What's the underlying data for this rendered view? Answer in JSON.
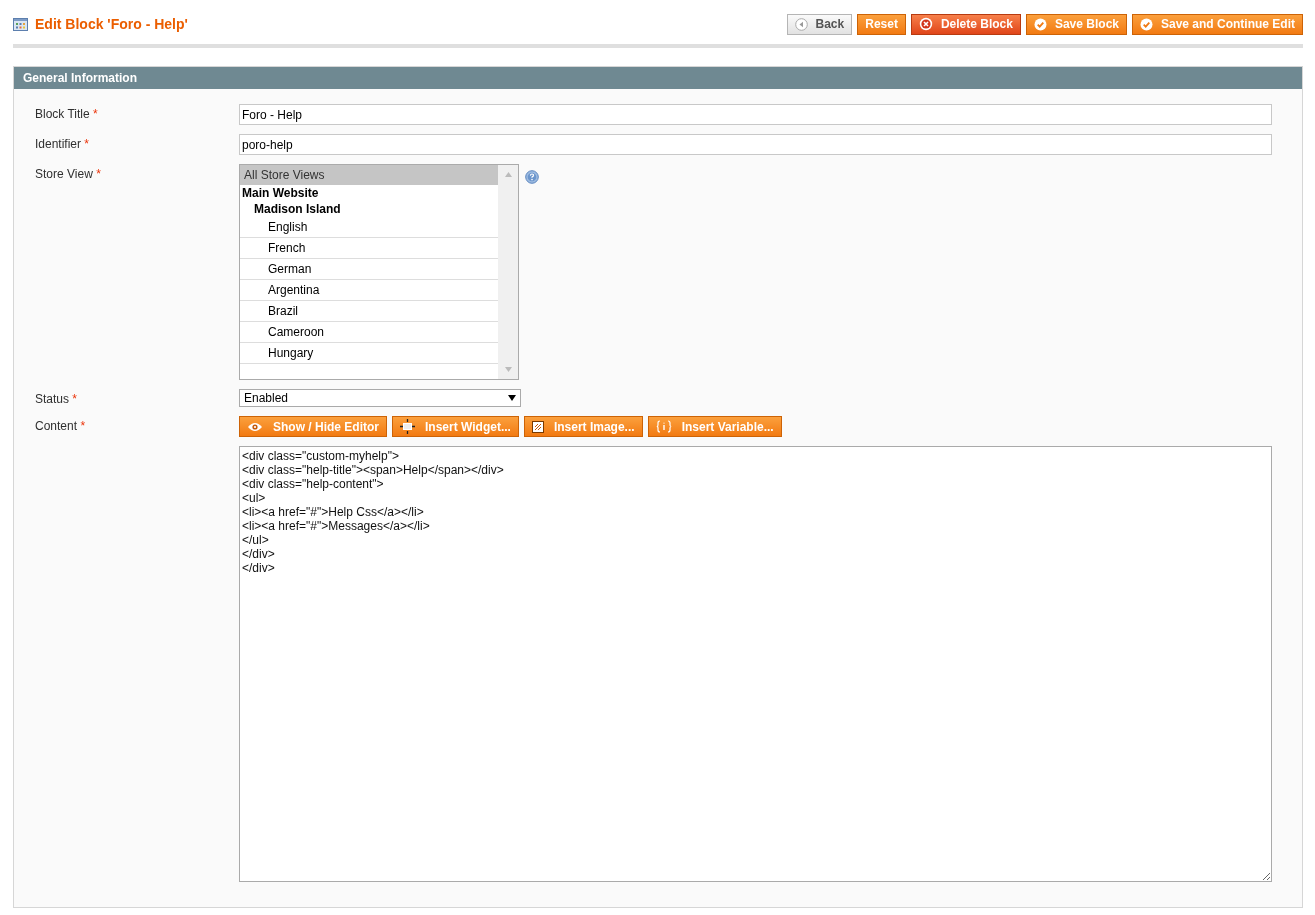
{
  "page_title": "Edit Block 'Foro - Help'",
  "actions": [
    {
      "label": "Back",
      "kind": "back"
    },
    {
      "label": "Reset",
      "kind": "plain"
    },
    {
      "label": "Delete Block",
      "kind": "delete"
    },
    {
      "label": "Save Block",
      "kind": "save"
    },
    {
      "label": "Save and Continue Edit",
      "kind": "save"
    }
  ],
  "section": {
    "title": "General Information"
  },
  "fields": {
    "block_title": {
      "label": "Block Title",
      "mark": "*",
      "value": "Foro - Help"
    },
    "identifier": {
      "label": "Identifier",
      "mark": "*",
      "value": "poro-help"
    },
    "store_view": {
      "label": "Store View",
      "mark": "*",
      "options": [
        {
          "label": "All Store Views",
          "kind": "option",
          "selected": true
        },
        {
          "label": "Main Website",
          "kind": "group",
          "children": [
            {
              "label": "Madison Island",
              "kind": "group",
              "children": [
                {
                  "label": "English",
                  "kind": "option",
                  "selected": false
                },
                {
                  "label": "French",
                  "kind": "option",
                  "selected": false
                },
                {
                  "label": "German",
                  "kind": "option",
                  "selected": false
                },
                {
                  "label": "Argentina",
                  "kind": "option",
                  "selected": false
                },
                {
                  "label": "Brazil",
                  "kind": "option",
                  "selected": false
                },
                {
                  "label": "Cameroon",
                  "kind": "option",
                  "selected": false
                },
                {
                  "label": "Hungary",
                  "kind": "option",
                  "selected": false
                }
              ]
            }
          ]
        }
      ]
    },
    "status": {
      "label": "Status",
      "mark": "*",
      "value": "Enabled"
    },
    "content": {
      "label": "Content",
      "mark": "*",
      "buttons": [
        {
          "label": "Show / Hide Editor",
          "kind": "eye"
        },
        {
          "label": "Insert Widget...",
          "kind": "widget"
        },
        {
          "label": "Insert Image...",
          "kind": "image"
        },
        {
          "label": "Insert Variable...",
          "kind": "variable"
        }
      ],
      "value": "<div class=\"custom-myhelp\">\n<div class=\"help-title\"><span>Help</span></div>\n<div class=\"help-content\">\n<ul>\n<li><a href=\"#\">Help Css</a></li>\n<li><a href=\"#\">Messages</a></li>\n</ul>\n</div>\n</div>"
    }
  }
}
